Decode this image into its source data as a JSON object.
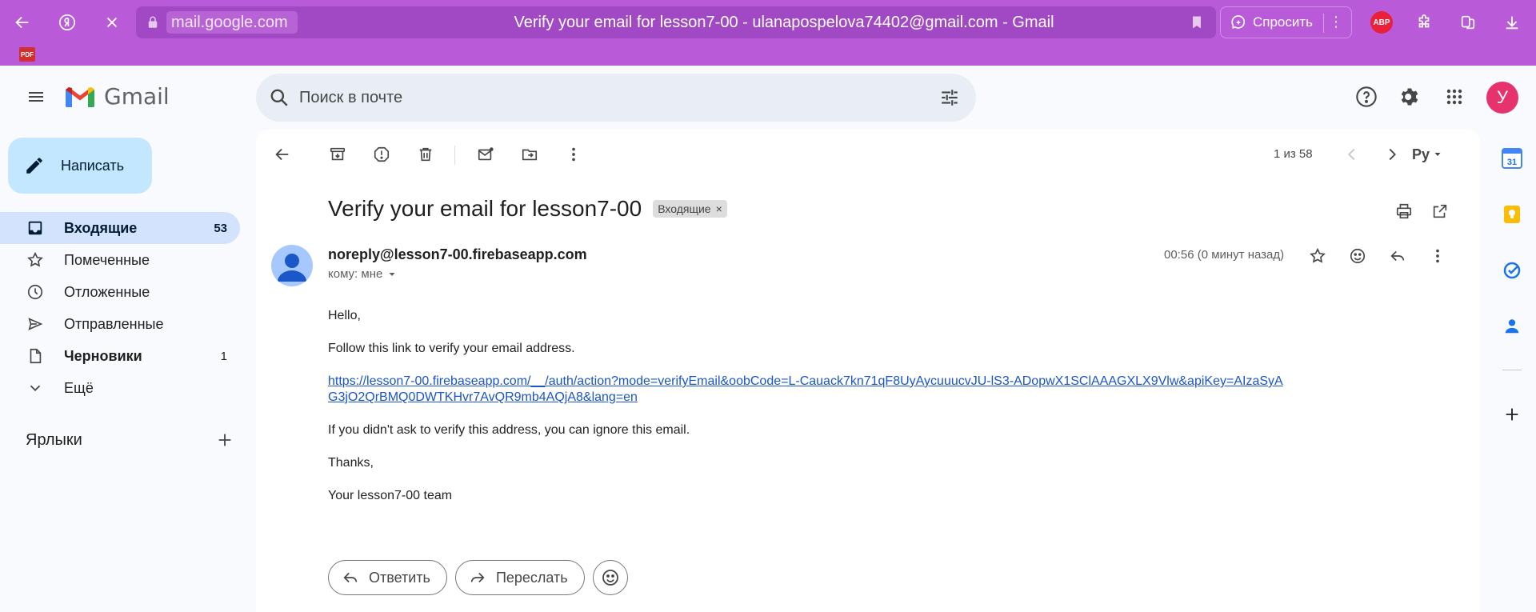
{
  "browser": {
    "domain": "mail.google.com",
    "page_title": "Verify your email for lesson7-00 - ulanapospelova74402@gmail.com - Gmail",
    "ask_label": "Спросить",
    "abp_label": "ABP",
    "pdf_label": "PDF"
  },
  "gmail": {
    "app_name": "Gmail",
    "search_placeholder": "Поиск в почте",
    "avatar_letter": "У"
  },
  "sidebar": {
    "compose_label": "Написать",
    "items": [
      {
        "label": "Входящие",
        "count": "53"
      },
      {
        "label": "Помеченные",
        "count": ""
      },
      {
        "label": "Отложенные",
        "count": ""
      },
      {
        "label": "Отправленные",
        "count": ""
      },
      {
        "label": "Черновики",
        "count": "1"
      },
      {
        "label": "Ещё",
        "count": ""
      }
    ],
    "labels_title": "Ярлыки"
  },
  "toolbar": {
    "pager": "1 из 58",
    "lang": "Ру"
  },
  "email": {
    "subject": "Verify your email for lesson7-00",
    "label_chip": "Входящие",
    "sender": "noreply@lesson7-00.firebaseapp.com",
    "to": "кому: мне",
    "time": "00:56 (0 минут назад)",
    "greeting": "Hello,",
    "line1": "Follow this link to verify your email address.",
    "link": "https://lesson7-00.firebaseapp.com/__/auth/action?mode=verifyEmail&oobCode=L-Cauack7kn71qF8UyAycuuucvJU-lS3-ADopwX1SClAAAGXLX9Vlw&apiKey=AIzaSyAG3jO2QrBMQ0DWTKHvr7AvQR9mb4AQjA8&lang=en",
    "line2": "If you didn't ask to verify this address, you can ignore this email.",
    "thanks": "Thanks,",
    "signature": "Your lesson7-00 team"
  },
  "actions": {
    "reply": "Ответить",
    "forward": "Переслать"
  },
  "sidepanel": {
    "calendar_day": "31"
  }
}
